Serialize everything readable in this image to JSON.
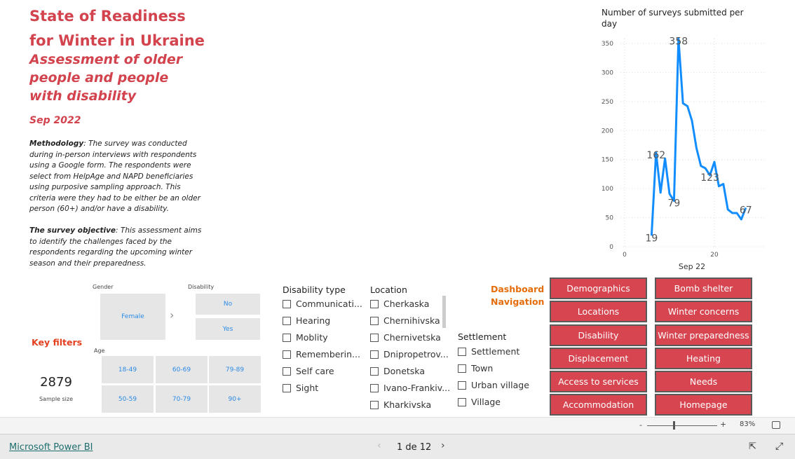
{
  "header": {
    "title": "State of Readiness for Winter in Ukraine",
    "subtitle": "Assessment of older people and people with disability",
    "date": "Sep 2022"
  },
  "methodology": {
    "label": "Methodology",
    "text": ": The survey was conducted during in-person interviews with respondents using a Google form. The respondents were select from HelpAge and NAPD beneficiaries using purposive sampling approach. This criteria were they had to be either be an older person (60+) and/or have a disability."
  },
  "objective": {
    "label": "The survey objective",
    "text": ": This assessment aims to identify the challenges faced by the respondents regarding the upcoming winter season and their preparedness."
  },
  "key_filters": "Key filters",
  "sample": {
    "value": "2879",
    "label": "Sample size"
  },
  "gender": {
    "label": "Gender",
    "options": [
      "Female"
    ]
  },
  "disability": {
    "label": "Disability",
    "options": [
      "No",
      "Yes"
    ]
  },
  "age": {
    "label": "Age",
    "options": [
      "18-49",
      "60-69",
      "79-89",
      "50-59",
      "70-79",
      "90+"
    ]
  },
  "disability_type": {
    "label": "Disability type",
    "options": [
      "Communicati...",
      "Hearing",
      "Moblity",
      "Rememberin...",
      "Self care",
      "Sight"
    ]
  },
  "location": {
    "label": "Location",
    "options": [
      "Cherkaska",
      "Chernihivska",
      "Chernivetska",
      "Dnipropetrov...",
      "Donetska",
      "Ivano-Frankiv...",
      "Kharkivska"
    ]
  },
  "settlement": {
    "label": "Settlement",
    "options": [
      "Settlement",
      "Town",
      "Urban village",
      "Village"
    ]
  },
  "navigation": {
    "label": "Dashboard Navigation",
    "left": [
      "Demographics",
      "Locations",
      "Disability",
      "Displacement",
      "Access to services",
      "Accommodation"
    ],
    "right": [
      "Bomb shelter",
      "Winter concerns",
      "Winter preparedness",
      "Heating",
      "Needs",
      "Homepage"
    ],
    "color": "#d64550"
  },
  "chart_data": {
    "type": "line",
    "title": "Number of surveys submitted per day",
    "xlabel": "Sep 22",
    "ylabel": "",
    "x": [
      6,
      7,
      8,
      9,
      10,
      11,
      12,
      13,
      14,
      15,
      16,
      17,
      18,
      19,
      20,
      21,
      22,
      23,
      24,
      25,
      26,
      27
    ],
    "values": [
      19,
      162,
      93,
      152,
      91,
      79,
      358,
      247,
      242,
      217,
      170,
      139,
      135,
      123,
      146,
      104,
      108,
      64,
      58,
      58,
      47,
      67
    ],
    "data_labels": {
      "6": "19",
      "7": "162",
      "11": "79",
      "12": "358",
      "19": "123",
      "27": "67"
    },
    "xticks": [
      0,
      20
    ],
    "yticks": [
      0,
      50,
      100,
      150,
      200,
      250,
      300,
      350
    ],
    "xlim": [
      0,
      30.5
    ],
    "ylim": [
      0,
      360
    ],
    "grid": true,
    "color": "#118dff"
  },
  "footer": {
    "zoom": "83%",
    "zoom_minus": "-",
    "zoom_plus": "+",
    "brand": "Microsoft Power BI",
    "page": "1 de 12"
  }
}
